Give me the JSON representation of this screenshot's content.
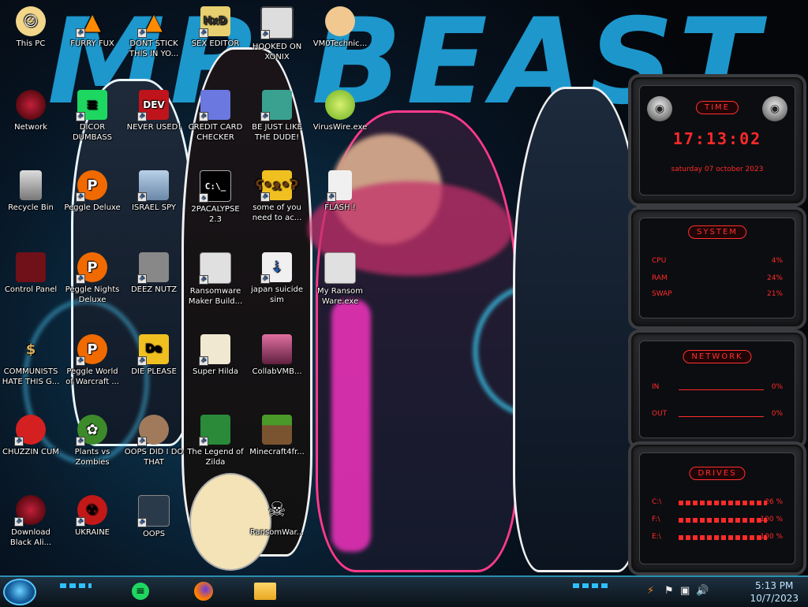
{
  "desktop": {
    "icons": [
      {
        "label": "This PC",
        "icon": "pc-character-icon"
      },
      {
        "label": "FURRY FUX",
        "icon": "vlc-cone-icon"
      },
      {
        "label": "DONT STICK THIS IN YO...",
        "icon": "vlc-cone-icon"
      },
      {
        "label": "SEX EDITOR",
        "icon": "hxd-editor-icon"
      },
      {
        "label": "HOOKED ON XONIX",
        "icon": "xonix-game-icon"
      },
      {
        "label": "VM0Technic...",
        "icon": "doctor-avatar-icon"
      },
      {
        "label": "Network",
        "icon": "alien-orb-icon"
      },
      {
        "label": "DICOR DUMBASS",
        "icon": "spotify-green-icon"
      },
      {
        "label": "NEVER USED!",
        "icon": "dev-cpp-icon"
      },
      {
        "label": "CREDIT CARD CHECKER",
        "icon": "credit-card-icon"
      },
      {
        "label": "BE JUST LIKE THE DUDE!",
        "icon": "santa-avatar-icon"
      },
      {
        "label": "VirusWire.exe",
        "icon": "lime-icon"
      },
      {
        "label": "Recycle Bin",
        "icon": "recycle-bin-icon"
      },
      {
        "label": "Peggle Deluxe",
        "icon": "peggle-icon"
      },
      {
        "label": "ISRAEL SPY",
        "icon": "network-computer-icon"
      },
      {
        "label": "2PACALYPSE 2.3",
        "icon": "terminal-icon"
      },
      {
        "label": "some of you need to ac...",
        "icon": "beaver-icon"
      },
      {
        "label": "FLASH !",
        "icon": "document-icon"
      },
      {
        "label": "Control Panel",
        "icon": "control-panel-icon"
      },
      {
        "label": "Peggle Nights Deluxe",
        "icon": "peggle-icon"
      },
      {
        "label": "DEEZ NUTZ",
        "icon": "windows-stack-icon"
      },
      {
        "label": "Ransomware Maker Build...",
        "icon": "app-window-icon"
      },
      {
        "label": "japan suicide sim",
        "icon": "installer-icon"
      },
      {
        "label": "My Ransom Ware.exe",
        "icon": "app-window-icon"
      },
      {
        "label": "COMMUNISTS HATE THIS G...",
        "icon": "money-bag-icon"
      },
      {
        "label": "Peggle World of Warcraft ...",
        "icon": "peggle-icon"
      },
      {
        "label": "DIE PLEASE",
        "icon": "die-logo-icon"
      },
      {
        "label": "Super Hilda",
        "icon": "pixel-dog-icon"
      },
      {
        "label": "CollabVMB...",
        "icon": "monitor-icon"
      },
      {
        "label": "CHUZZIN CUM",
        "icon": "chuzzle-icon"
      },
      {
        "label": "Plants vs Zombies",
        "icon": "plant-icon"
      },
      {
        "label": "OOPS DID I DO THAT",
        "icon": "portrait-icon"
      },
      {
        "label": "The Legend of Zilda",
        "icon": "pixel-hero-icon"
      },
      {
        "label": "Minecraft4fr...",
        "icon": "grass-block-icon"
      },
      {
        "label": "Download Black Ali...",
        "icon": "alien-orb-icon"
      },
      {
        "label": "UKRAINE",
        "icon": "radiation-icon"
      },
      {
        "label": "OOPS",
        "icon": "monitor-icon"
      },
      {
        "label": "RansomWar...",
        "icon": "skull-icon"
      }
    ],
    "wallpaper_text": "MR BEAST"
  },
  "gadgets": {
    "time": {
      "title": "TIME",
      "clock": "17:13:02",
      "date": "saturday 07 october 2023"
    },
    "system": {
      "title": "SYSTEM",
      "rows": [
        {
          "label": "CPU",
          "value": "4%"
        },
        {
          "label": "RAM",
          "value": "24%"
        },
        {
          "label": "SWAP",
          "value": "21%"
        }
      ]
    },
    "network": {
      "title": "NETWORK",
      "rows": [
        {
          "label": "IN",
          "value": "0%"
        },
        {
          "label": "OUT",
          "value": "0%"
        }
      ]
    },
    "drives": {
      "title": "DRIVES",
      "rows": [
        {
          "label": "C:\\",
          "value": "26 %"
        },
        {
          "label": "F:\\",
          "value": "100 %"
        },
        {
          "label": "E:\\",
          "value": "100 %"
        }
      ]
    }
  },
  "taskbar": {
    "apps": [
      "spotify-icon",
      "firefox-icon",
      "file-explorer-icon"
    ],
    "tray_icons": [
      "alert-icon",
      "flag-icon",
      "network-icon",
      "speaker-icon"
    ],
    "time": "5:13 PM",
    "date": "10/7/2023"
  },
  "colors": {
    "accent": "#1f9fd6",
    "gadget_red": "#ff2a2a",
    "taskbar_border": "#2a8fb0"
  }
}
